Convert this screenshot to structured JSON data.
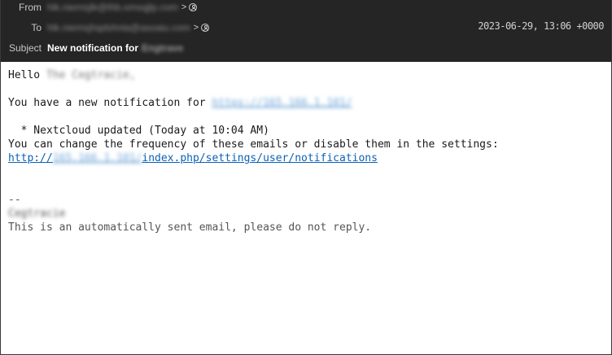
{
  "header": {
    "from_label": "From",
    "from_address": "hlk.niemsjlk@lhb.omsqjlp.com",
    "to_label": "To",
    "to_address": "hlk.niemsjhqdshnla@asoaiu.com",
    "chevron": ">",
    "date": "2023-06-29, 13:06 +0000",
    "subject_label": "Subject",
    "subject_text": "New notification for",
    "subject_name": "Engtrave"
  },
  "body": {
    "greeting_word": "Hello",
    "greeting_name": "The Cegtracie,",
    "notice_text": "You have a new notification for ",
    "notice_link": "https://165.166.1.101/",
    "bullet": "  * Nextcloud updated (Today at 10:04 AM)",
    "frequency_text": "You can change the frequency of these emails or disable them in the settings:",
    "settings_link_prefix": "http://",
    "settings_link_host": "165.166.1.101/",
    "settings_link_path": "index.php/settings/user/notifications",
    "signature_dashes": "--",
    "signature_name": "Cegtracie",
    "footer": "This is an automatically sent email, please do not reply."
  }
}
